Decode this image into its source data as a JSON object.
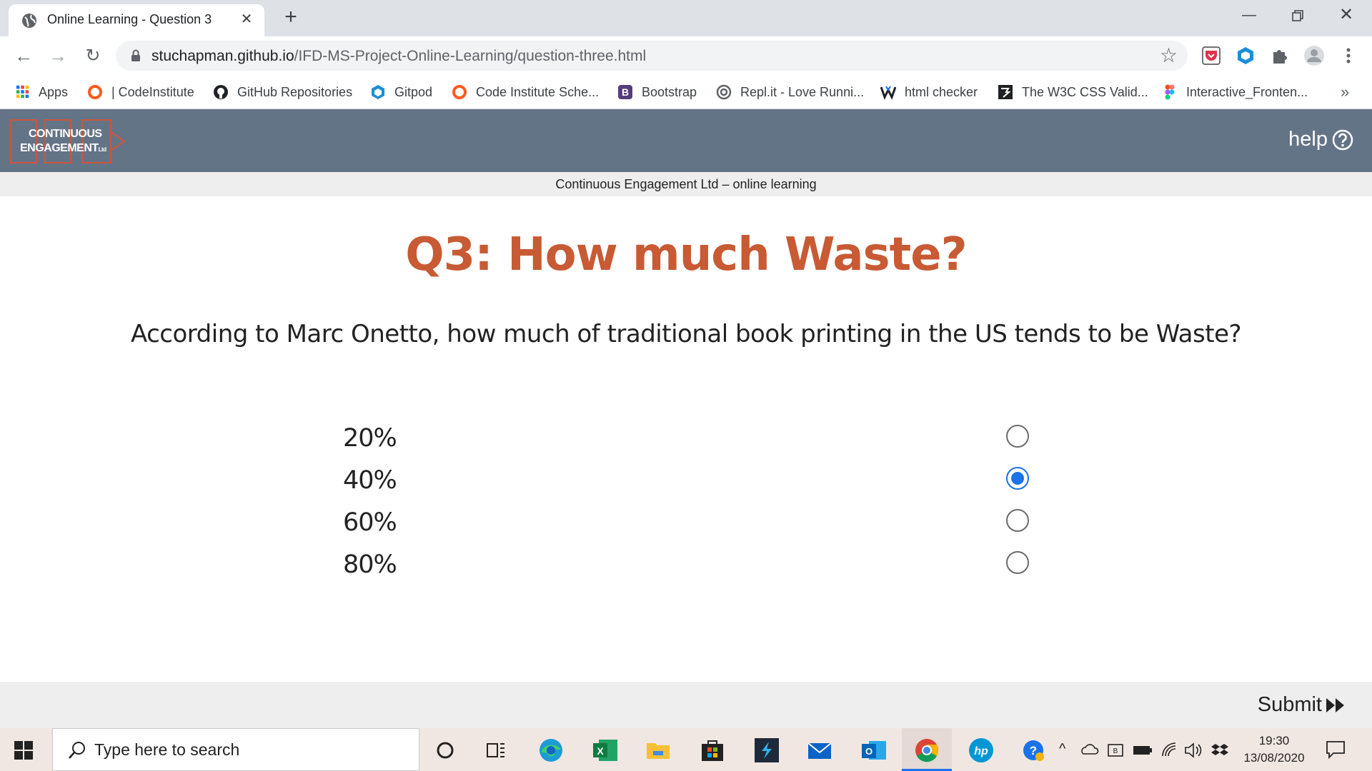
{
  "browser": {
    "tab_title": "Online Learning - Question 3",
    "url_host": "stuchapman.github.io",
    "url_path": "/IFD-MS-Project-Online-Learning/question-three.html",
    "bookmarks": [
      {
        "label": "Apps",
        "icon": "apps-grid-icon"
      },
      {
        "label": "| CodeInstitute",
        "icon": "code-institute-icon"
      },
      {
        "label": "GitHub Repositories",
        "icon": "github-icon"
      },
      {
        "label": "Gitpod",
        "icon": "gitpod-icon"
      },
      {
        "label": "Code Institute Sche...",
        "icon": "code-institute-icon"
      },
      {
        "label": "Bootstrap",
        "icon": "bootstrap-icon"
      },
      {
        "label": "Repl.it - Love Runni...",
        "icon": "replit-icon"
      },
      {
        "label": "html checker",
        "icon": "w3c-icon"
      },
      {
        "label": "The W3C CSS Valid...",
        "icon": "w3c-css-icon"
      },
      {
        "label": "Interactive_Fronten...",
        "icon": "figma-icon"
      }
    ],
    "more_bookmarks": "»"
  },
  "header": {
    "logo_line1": "CONTINUOUS",
    "logo_line2": "ENGAGEMENT",
    "logo_ltd": "Ltd",
    "help_label": "help"
  },
  "subtitle": "Continuous Engagement Ltd – online learning",
  "question": {
    "title": "Q3: How much Waste?",
    "text": "According to Marc Onetto, how much of traditional book printing in the US tends to be Waste?",
    "options": [
      {
        "label": "20%",
        "selected": false
      },
      {
        "label": "40%",
        "selected": true
      },
      {
        "label": "60%",
        "selected": false
      },
      {
        "label": "80%",
        "selected": false
      }
    ]
  },
  "submit_label": "Submit",
  "taskbar": {
    "search_placeholder": "Type here to search",
    "time": "19:30",
    "date": "13/08/2020"
  },
  "colors": {
    "header_bg": "#647487",
    "title_color": "#c85a34",
    "radio_selected": "#1a73e8"
  }
}
